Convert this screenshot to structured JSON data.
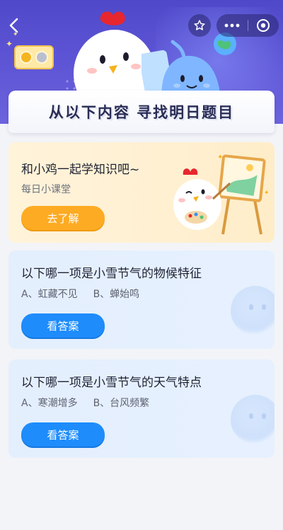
{
  "header": {
    "back_icon": "chevron-left-icon",
    "favorite_icon": "star-outline-icon",
    "more_icon": "more-dots-icon",
    "close_icon": "target-circle-icon"
  },
  "banner": {
    "title": "从以下内容 寻找明日题目"
  },
  "promo": {
    "title": "和小鸡一起学知识吧~",
    "subtitle": "每日小课堂",
    "button_label": "去了解"
  },
  "questions": [
    {
      "title": "以下哪一项是小雪节气的物候特征",
      "options": [
        "A、虹藏不见",
        "B、蝉始鸣"
      ],
      "button_label": "看答案"
    },
    {
      "title": "以下哪一项是小雪节气的天气特点",
      "options": [
        "A、寒潮增多",
        "B、台风频繁"
      ],
      "button_label": "看答案"
    }
  ],
  "colors": {
    "header_bg": "#5a52d2",
    "orange_button": "#fdab23",
    "blue_button": "#1e8cfb",
    "promo_bg": "#fff1d4",
    "question_bg": "#e5effd"
  }
}
